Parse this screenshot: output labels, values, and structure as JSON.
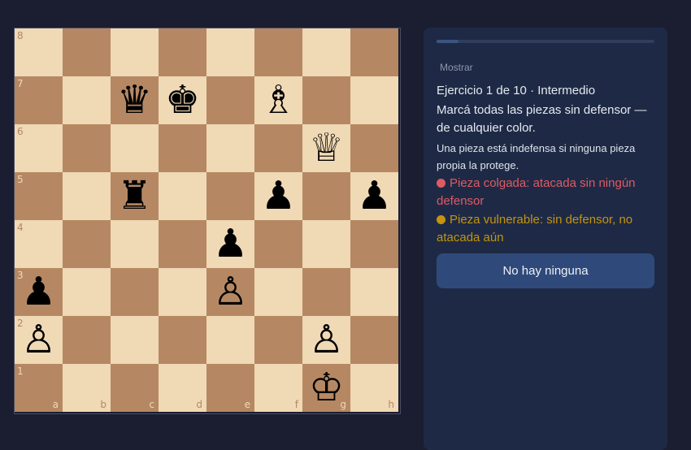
{
  "board": {
    "files": [
      "a",
      "b",
      "c",
      "d",
      "e",
      "f",
      "g",
      "h"
    ],
    "ranks": [
      "8",
      "7",
      "6",
      "5",
      "4",
      "3",
      "2",
      "1"
    ],
    "pieces": [
      {
        "square": "c7",
        "glyph": "♛",
        "name": "black-queen-icon"
      },
      {
        "square": "d7",
        "glyph": "♚",
        "name": "black-king-icon"
      },
      {
        "square": "f7",
        "glyph": "♗",
        "name": "white-bishop-icon"
      },
      {
        "square": "g6",
        "glyph": "♕",
        "name": "white-queen-icon"
      },
      {
        "square": "c5",
        "glyph": "♜",
        "name": "black-rook-icon"
      },
      {
        "square": "f5",
        "glyph": "♟",
        "name": "black-pawn-icon"
      },
      {
        "square": "h5",
        "glyph": "♟",
        "name": "black-pawn-icon"
      },
      {
        "square": "e4",
        "glyph": "♟",
        "name": "black-pawn-icon"
      },
      {
        "square": "a3",
        "glyph": "♟",
        "name": "black-pawn-icon"
      },
      {
        "square": "e3",
        "glyph": "♙",
        "name": "white-pawn-icon"
      },
      {
        "square": "a2",
        "glyph": "♙",
        "name": "white-pawn-icon"
      },
      {
        "square": "g2",
        "glyph": "♙",
        "name": "white-pawn-icon"
      },
      {
        "square": "g1",
        "glyph": "♔",
        "name": "white-king-icon"
      }
    ],
    "colors": {
      "light": "#f0d9b5",
      "dark": "#b58863"
    }
  },
  "panel": {
    "progress": 0.1,
    "show_label": "Mostrar",
    "exercise_title": "Ejercicio 1 de 10 · Intermedio",
    "instruction": "Marcá todas las piezas sin defensor — de cualquier color.",
    "hint": "Una pieza está indefensa si ninguna pieza propia la protege.",
    "legend_hanging": "Pieza colgada: atacada sin ningún defensor",
    "legend_vulnerable": "Pieza vulnerable: sin defensor, no atacada aún",
    "none_button": "No hay ninguna",
    "colors": {
      "hanging": "#e05a63",
      "vulnerable": "#c4940f",
      "button": "#2f4a7a"
    }
  }
}
